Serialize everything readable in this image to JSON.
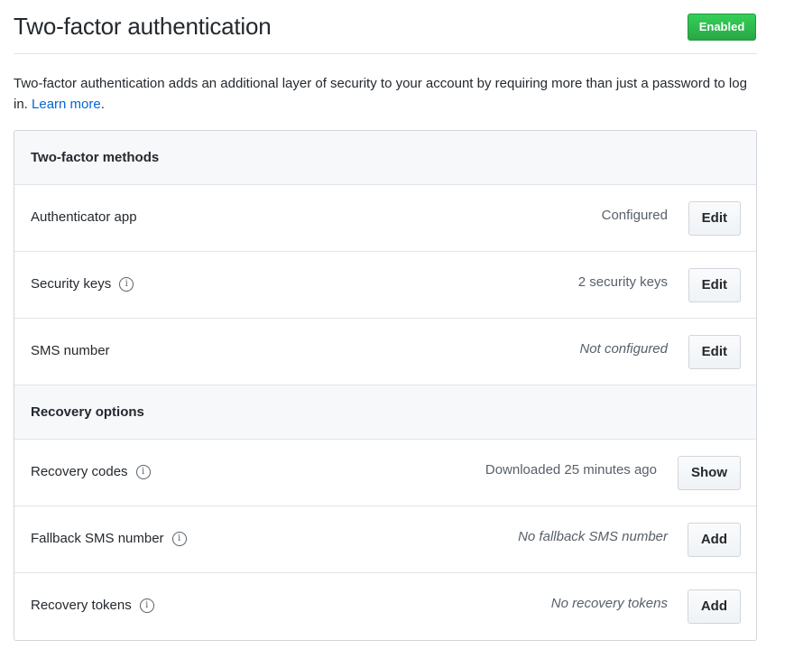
{
  "header": {
    "title": "Two-factor authentication",
    "status_badge": "Enabled",
    "status_color": "#28a745"
  },
  "intro": {
    "text": "Two-factor authentication adds an additional layer of security to your account by requiring more than just a password to log in. ",
    "link": "Learn more",
    "suffix": "."
  },
  "sections": [
    {
      "title": "Two-factor methods",
      "rows": [
        {
          "label": "Authenticator app",
          "info": false,
          "status": "Configured",
          "status_italic": false,
          "button": "Edit"
        },
        {
          "label": "Security keys",
          "info": true,
          "status": "2 security keys",
          "status_italic": false,
          "button": "Edit"
        },
        {
          "label": "SMS number",
          "info": false,
          "status": "Not configured",
          "status_italic": true,
          "button": "Edit"
        }
      ]
    },
    {
      "title": "Recovery options",
      "rows": [
        {
          "label": "Recovery codes",
          "info": true,
          "status": "Downloaded 25 minutes ago",
          "status_italic": false,
          "button": "Show"
        },
        {
          "label": "Fallback SMS number",
          "info": true,
          "status": "No fallback SMS number",
          "status_italic": true,
          "button": "Add"
        },
        {
          "label": "Recovery tokens",
          "info": true,
          "status": "No recovery tokens",
          "status_italic": true,
          "button": "Add"
        }
      ]
    }
  ],
  "icons": {
    "info": "i"
  }
}
